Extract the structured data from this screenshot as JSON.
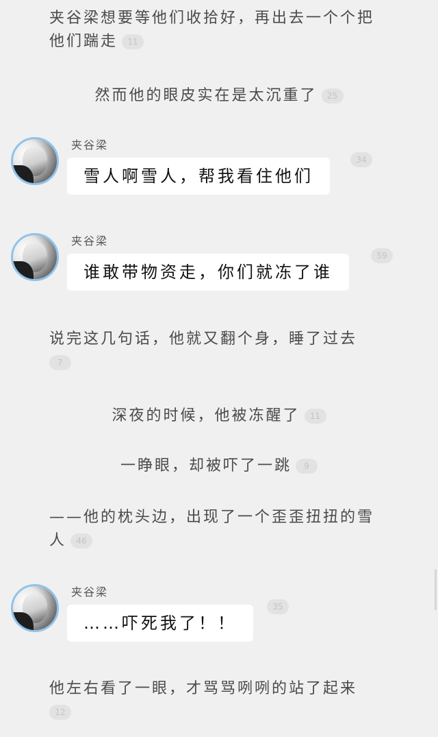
{
  "feed": {
    "p1": {
      "text": "夹谷梁想要等他们收拾好，再出去一个个把他们踹走",
      "count": "11"
    },
    "p2": {
      "text": "然而他的眼皮实在是太沉重了",
      "count": "25"
    },
    "m1": {
      "author": "夹谷梁",
      "text": "雪人啊雪人，帮我看住他们",
      "count": "34"
    },
    "m2": {
      "author": "夹谷梁",
      "text": "谁敢带物资走，你们就冻了谁",
      "count": "59"
    },
    "p3": {
      "text": "说完这几句话，他就又翻个身，睡了过去",
      "count": "7"
    },
    "p4": {
      "text": "深夜的时候，他被冻醒了",
      "count": "11"
    },
    "p5": {
      "text": "一睁眼，却被吓了一跳",
      "count": "9"
    },
    "p6": {
      "text": "——他的枕头边，出现了一个歪歪扭扭的雪人",
      "count": "46"
    },
    "m3": {
      "author": "夹谷梁",
      "text": "……吓死我了！！",
      "count": "35"
    },
    "p7": {
      "text": "他左右看了一眼，才骂骂咧咧的站了起来",
      "count": "12"
    }
  },
  "colors": {
    "avatar_ring": "#8fc3ea",
    "badge_bg": "#e2e2e2",
    "background": "#f0f0f0"
  }
}
